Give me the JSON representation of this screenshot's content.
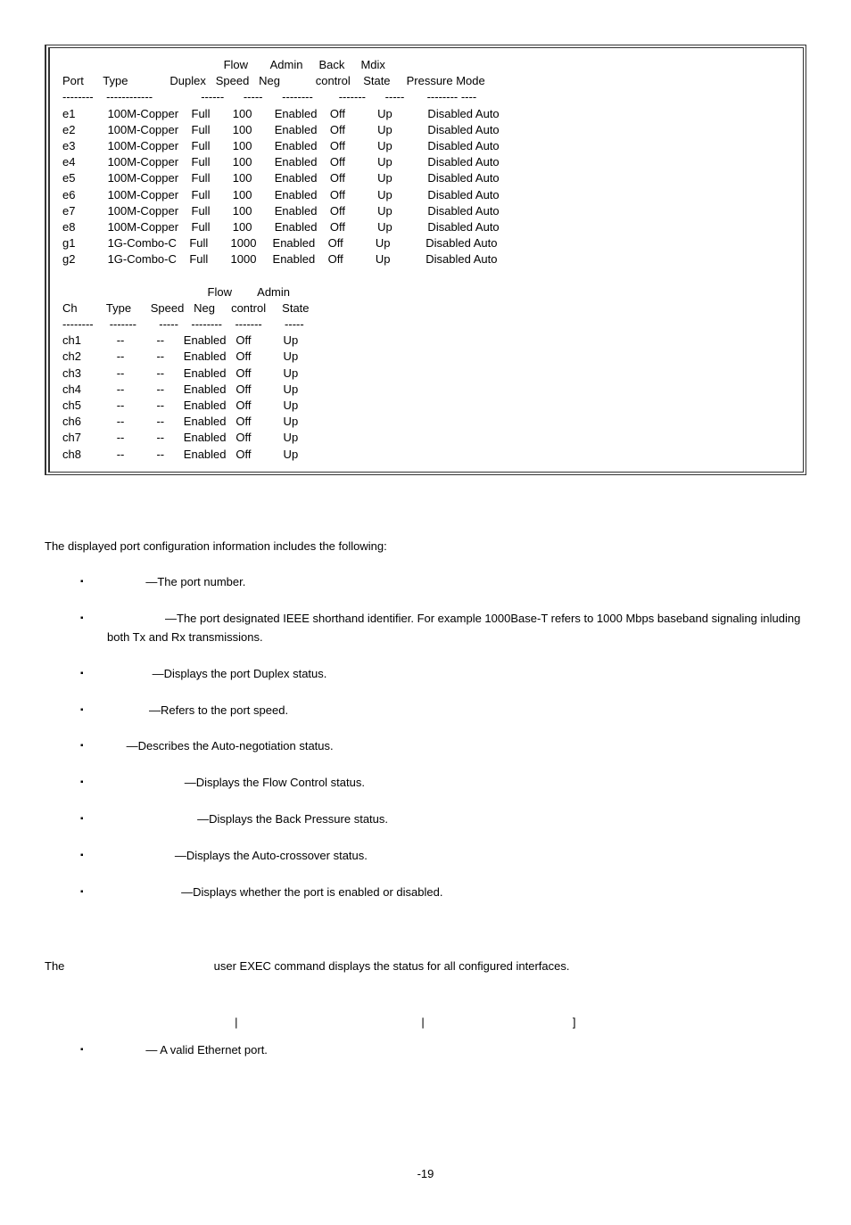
{
  "table1": {
    "header_line1": "                                                  Flow       Admin     Back     Mdix",
    "header_line2": "Port      Type             Duplex   Speed   Neg           control    State     Pressure Mode",
    "header_sep": "--------    ------------               ------      -----      --------        -------      -----       -------- ----",
    "rows": [
      "e1          100M-Copper    Full       100       Enabled    Off          Up           Disabled Auto",
      "e2          100M-Copper    Full       100       Enabled    Off          Up           Disabled Auto",
      "e3          100M-Copper    Full       100       Enabled    Off          Up           Disabled Auto",
      "e4          100M-Copper    Full       100       Enabled    Off          Up           Disabled Auto",
      "e5          100M-Copper    Full       100       Enabled    Off          Up           Disabled Auto",
      "e6          100M-Copper    Full       100       Enabled    Off          Up           Disabled Auto",
      "e7          100M-Copper    Full       100       Enabled    Off          Up           Disabled Auto",
      "e8          100M-Copper    Full       100       Enabled    Off          Up           Disabled Auto",
      "g1          1G-Combo-C    Full       1000     Enabled    Off          Up           Disabled Auto",
      "g2          1G-Combo-C    Full       1000     Enabled    Off          Up           Disabled Auto"
    ],
    "header2_line1": "                                             Flow        Admin",
    "header2_line2": "Ch         Type      Speed   Neg     control     State",
    "header2_sep": "--------     -------       -----    --------    -------       -----",
    "rows2": [
      "ch1           --          --      Enabled   Off          Up",
      "ch2           --          --      Enabled   Off          Up",
      "ch3           --          --      Enabled   Off          Up",
      "ch4           --          --      Enabled   Off          Up",
      "ch5           --          --      Enabled   Off          Up",
      "ch6           --          --      Enabled   Off          Up",
      "ch7           --          --      Enabled   Off          Up",
      "ch8           --          --      Enabled   Off          Up"
    ]
  },
  "intro_line": "The displayed port configuration information includes the following:",
  "bullets": [
    "            —The port number.",
    "                  —The port designated IEEE shorthand identifier. For example 1000Base-T refers to 1000 Mbps baseband signaling inluding both Tx and Rx transmissions.",
    "              —Displays the port Duplex status.",
    "             —Refers to the port speed.",
    "      —Describes the Auto-negotiation status.",
    "                        —Displays the Flow Control status.",
    "                            —Displays the Back Pressure status.",
    "                     —Displays the Auto-crossover status.",
    "                       —Displays whether the port is enabled or disabled."
  ],
  "para2_left": "The ",
  "para2_right": " user EXEC command displays the status for all configured interfaces.",
  "syntax_line": "                                                           |                                                         |                                              ]",
  "bullet2": "            — A valid Ethernet port.",
  "page_number": "-19"
}
